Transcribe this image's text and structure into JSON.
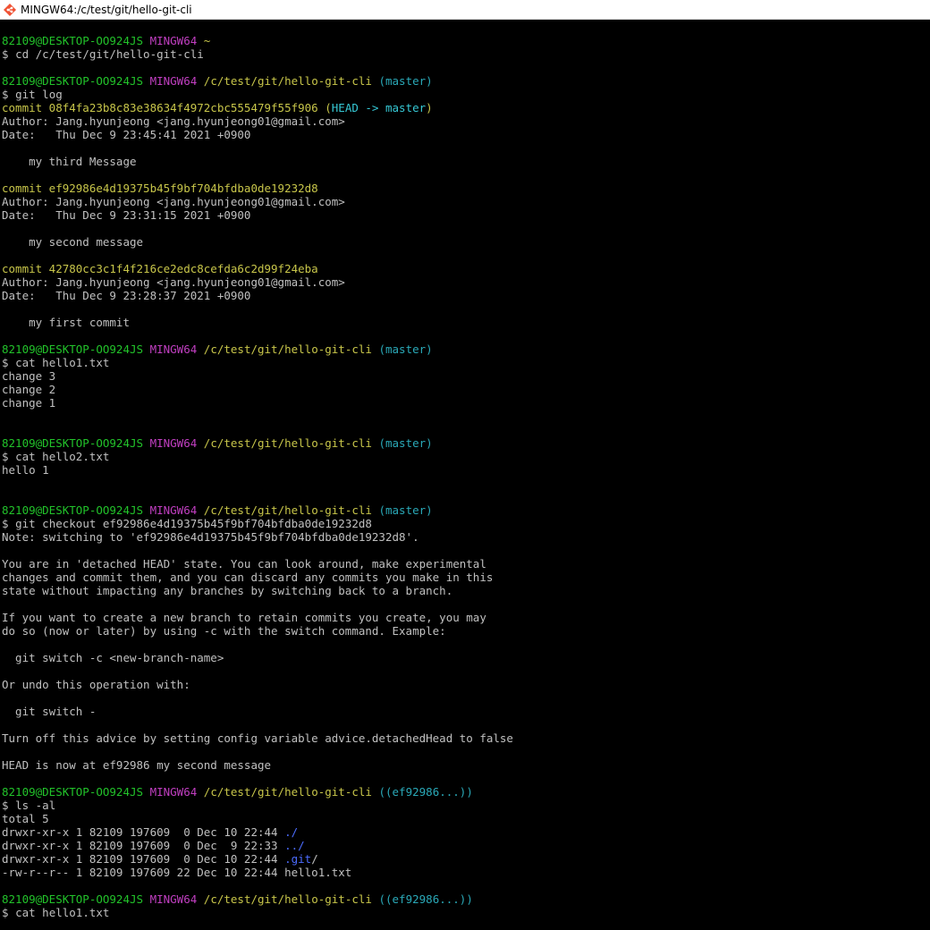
{
  "window": {
    "title": "MINGW64:/c/test/git/hello-git-cli"
  },
  "colors": {
    "background": "#000000",
    "text": "#c0c0c0",
    "user_host": "#22c32a",
    "mingw": "#c13fc1",
    "path": "#c8c64a",
    "branch": "#2aa9b8",
    "dir_entry": "#4c6cff"
  },
  "prompt": {
    "user_host": "82109@DESKTOP-OO924JS",
    "env": "MINGW64",
    "home": "~",
    "path": "/c/test/git/hello-git-cli",
    "branch_master": "(master)",
    "branch_detached": "((ef92986...))",
    "symbol": "$"
  },
  "commands": {
    "cd": "cd /c/test/git/hello-git-cli",
    "git_log": "git log",
    "cat_hello1": "cat hello1.txt",
    "cat_hello2": "cat hello2.txt",
    "checkout": "git checkout ef92986e4d19375b45f9bf704bfdba0de19232d8",
    "ls": "ls -al",
    "cat_hello1_again": "cat hello1.txt"
  },
  "log": [
    {
      "commit_label": "commit 08f4fa23b8c83e38634f4972cbc555479f55f906",
      "ref_open": " (",
      "ref_head": "HEAD -> master",
      "ref_close": ")",
      "author": "Author: Jang.hyunjeong <jang.hyunjeong01@gmail.com>",
      "date": "Date:   Thu Dec 9 23:45:41 2021 +0900",
      "message": "    my third Message"
    },
    {
      "commit_label": "commit ef92986e4d19375b45f9bf704bfdba0de19232d8",
      "author": "Author: Jang.hyunjeong <jang.hyunjeong01@gmail.com>",
      "date": "Date:   Thu Dec 9 23:31:15 2021 +0900",
      "message": "    my second message"
    },
    {
      "commit_label": "commit 42780cc3c1f4f216ce2edc8cefda6c2d99f24eba",
      "author": "Author: Jang.hyunjeong <jang.hyunjeong01@gmail.com>",
      "date": "Date:   Thu Dec 9 23:28:37 2021 +0900",
      "message": "    my first commit"
    }
  ],
  "hello1_output": [
    "change 3",
    "change 2",
    "change 1"
  ],
  "hello2_output": [
    "hello 1"
  ],
  "checkout_output": [
    "Note: switching to 'ef92986e4d19375b45f9bf704bfdba0de19232d8'.",
    "You are in 'detached HEAD' state. You can look around, make experimental",
    "changes and commit them, and you can discard any commits you make in this",
    "state without impacting any branches by switching back to a branch.",
    "If you want to create a new branch to retain commits you create, you may",
    "do so (now or later) by using -c with the switch command. Example:",
    "  git switch -c <new-branch-name>",
    "Or undo this operation with:",
    "  git switch -",
    "Turn off this advice by setting config variable advice.detachedHead to false",
    "HEAD is now at ef92986 my second message"
  ],
  "ls_output": {
    "total": "total 5",
    "rows": [
      {
        "meta": "drwxr-xr-x 1 82109 197609  0 Dec 10 22:44 ",
        "name": "./"
      },
      {
        "meta": "drwxr-xr-x 1 82109 197609  0 Dec  9 22:33 ",
        "name": "../"
      },
      {
        "meta": "drwxr-xr-x 1 82109 197609  0 Dec 10 22:44 ",
        "name": ".git",
        "suffix": "/"
      },
      {
        "meta": "-rw-r--r-- 1 82109 197609 22 Dec 10 22:44 ",
        "name": "hello1.txt"
      }
    ]
  }
}
